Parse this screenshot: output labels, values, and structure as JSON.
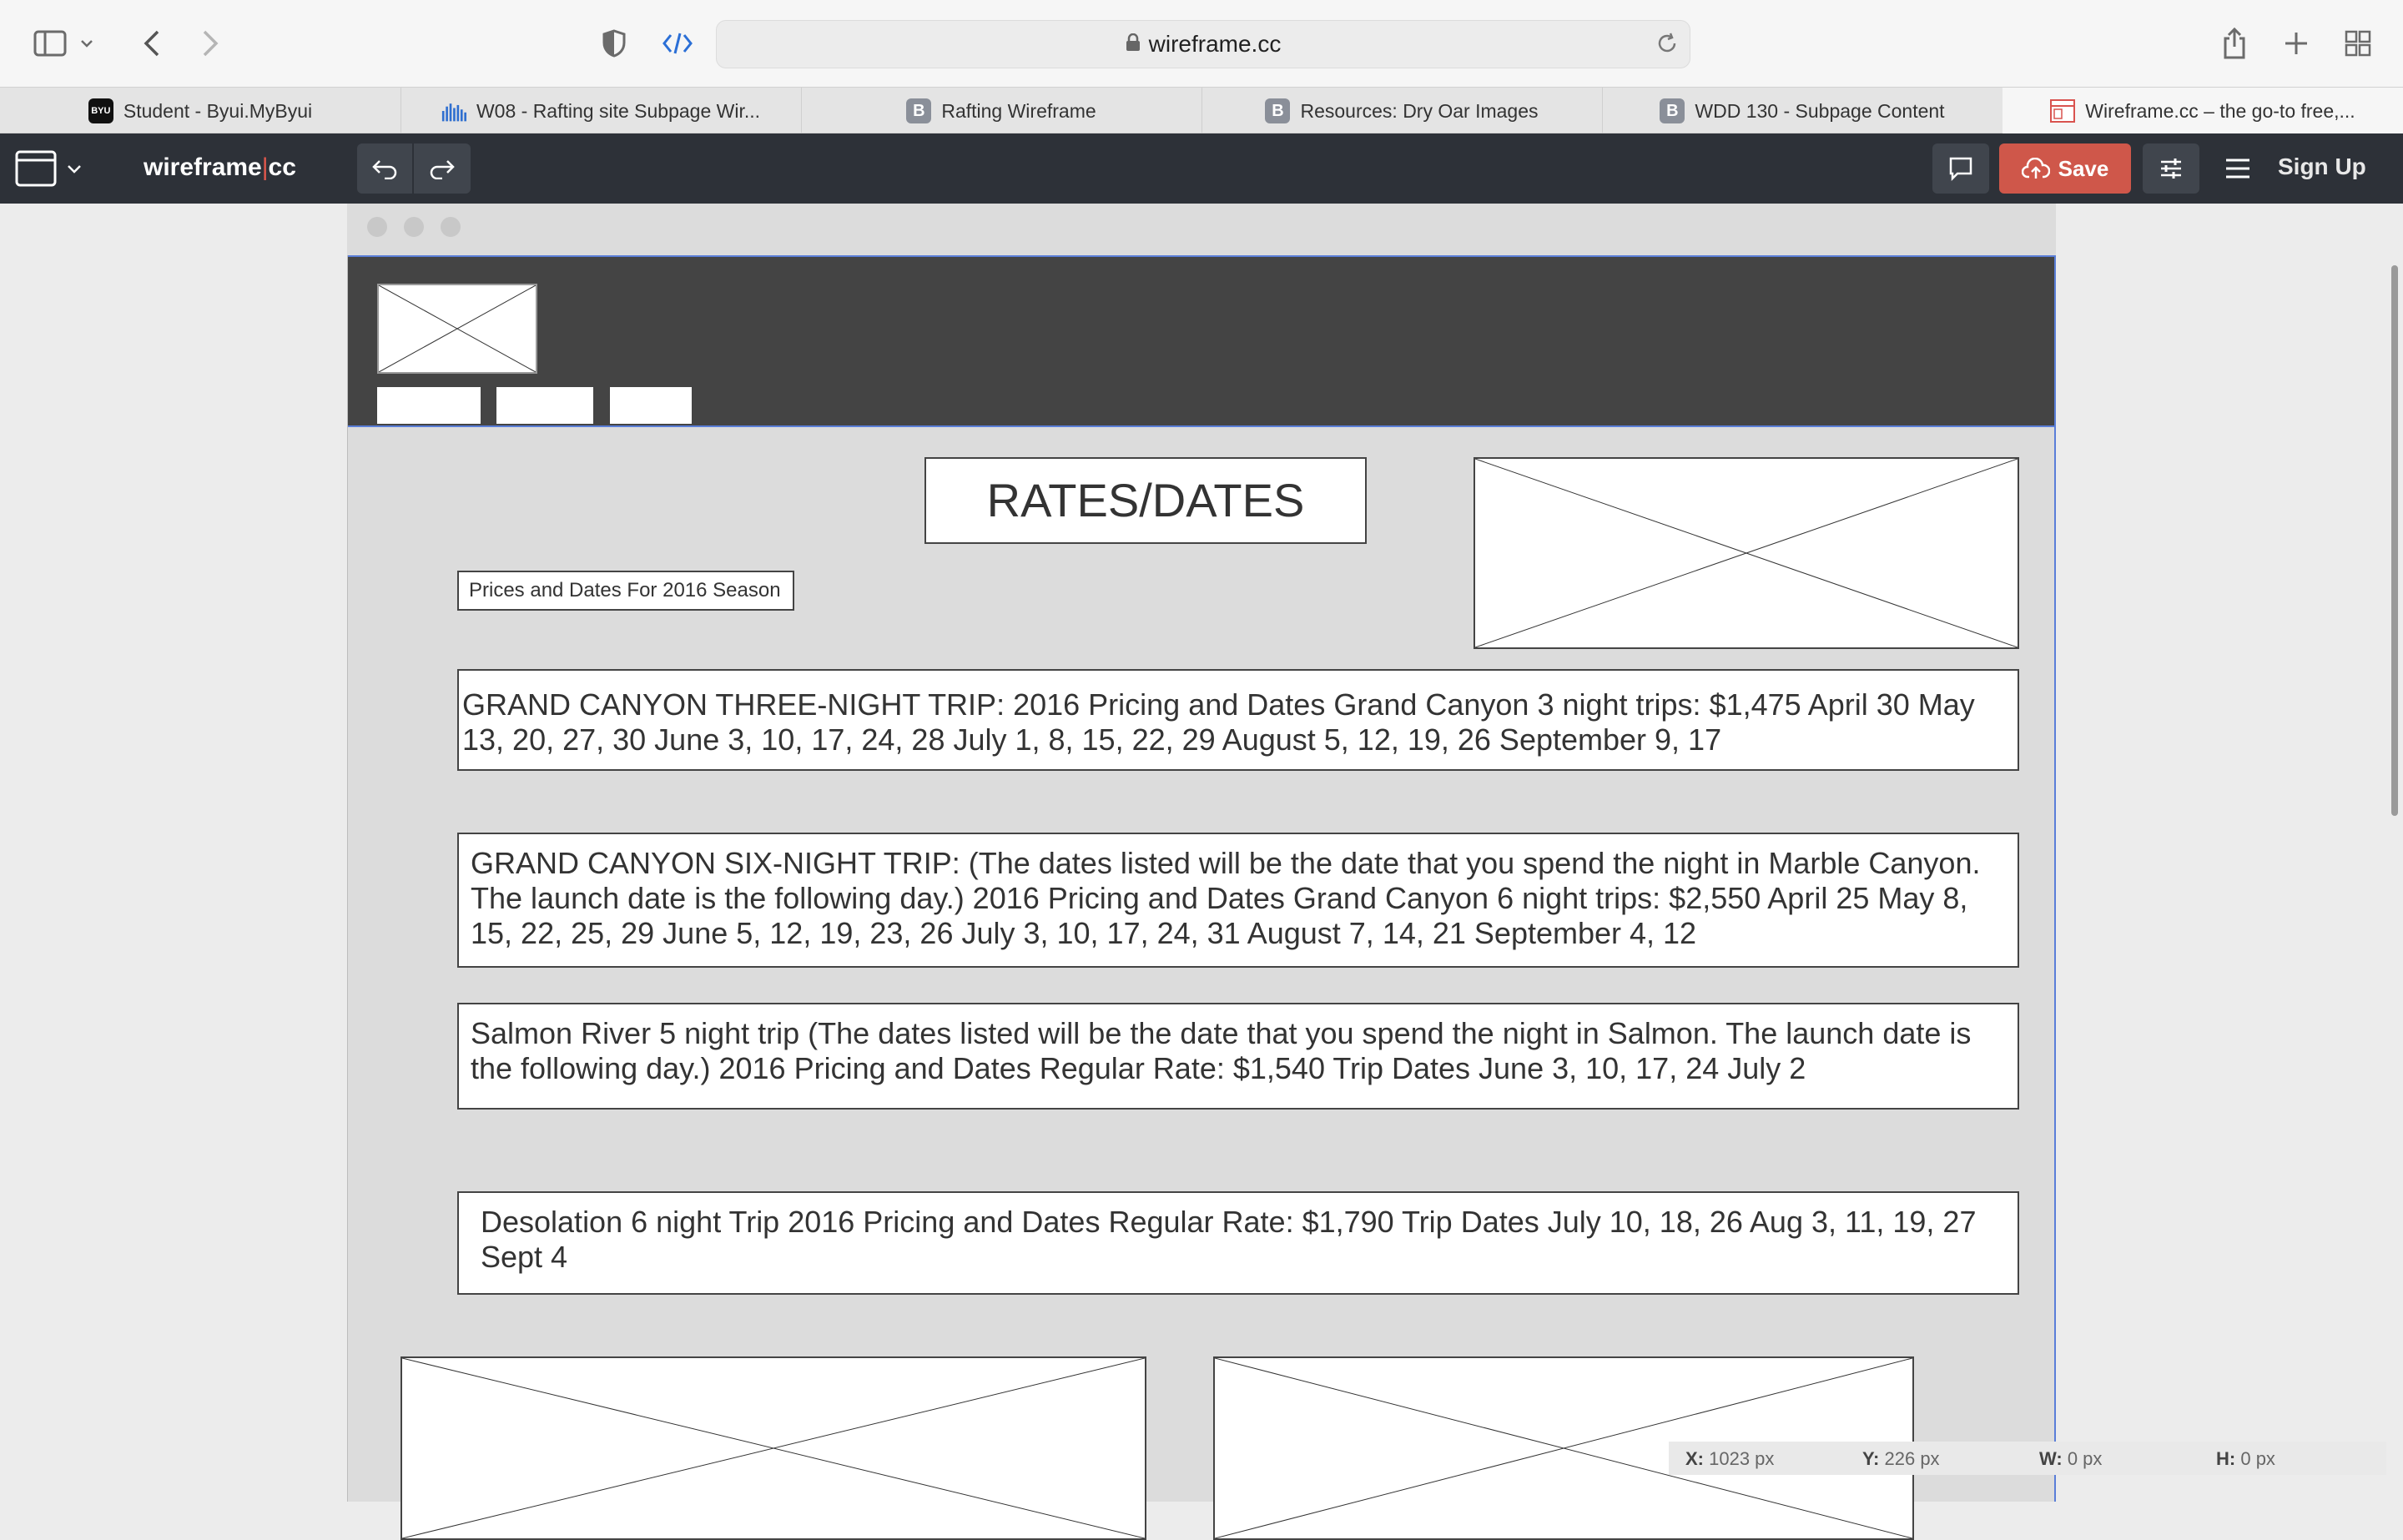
{
  "browser": {
    "url": "wireframe.cc",
    "tabs": [
      {
        "label": "Student - Byui.MyByui",
        "icon": "byui-icon"
      },
      {
        "label": "W08 - Rafting site Subpage Wir...",
        "icon": "chart-bars-icon"
      },
      {
        "label": "Rafting Wireframe",
        "icon": "b-icon"
      },
      {
        "label": "Resources: Dry Oar Images",
        "icon": "b-icon"
      },
      {
        "label": "WDD 130 - Subpage Content",
        "icon": "b-icon"
      },
      {
        "label": "Wireframe.cc – the go-to free,...",
        "icon": "wireframe-icon",
        "active": true
      }
    ]
  },
  "app": {
    "logo_left": "wireframe",
    "logo_right": "cc",
    "save_label": "Save",
    "signup_label": "Sign Up"
  },
  "wireframe": {
    "title": "RATES/DATES",
    "subtitle": "Prices and Dates For 2016 Season",
    "trips": [
      "GRAND CANYON THREE-NIGHT TRIP: 2016 Pricing and Dates Grand Canyon 3 night trips: $1,475 April 30 May 13, 20, 27, 30 June 3, 10, 17, 24, 28 July 1, 8, 15, 22, 29 August 5, 12, 19, 26 September 9, 17",
      "GRAND CANYON SIX-NIGHT TRIP: (The dates listed will be the date that you spend the night in Marble Canyon. The launch date is the following day.) 2016 Pricing and Dates Grand Canyon 6 night trips: $2,550 April 25 May 8, 15, 22, 25, 29 June 5, 12, 19, 23, 26 July 3, 10, 17, 24, 31 August 7, 14, 21 September 4, 12",
      "Salmon River 5 night trip (The dates listed will be the date that you spend the night in Salmon. The launch date is the following day.) 2016 Pricing and Dates Regular Rate: $1,540 Trip Dates June 3, 10, 17, 24 July 2",
      "Desolation 6 night Trip 2016 Pricing and Dates Regular Rate: $1,790 Trip Dates July 10, 18, 26 Aug 3, 11, 19, 27 Sept 4"
    ]
  },
  "status": {
    "x_label": "X:",
    "x_value": "1023 px",
    "y_label": "Y:",
    "y_value": "226 px",
    "w_label": "W:",
    "w_value": "0 px",
    "h_label": "H:",
    "h_value": "0 px"
  },
  "colors": {
    "accent_save": "#cf574a",
    "selection_blue": "#5a7ed8",
    "app_bar": "#2d3138",
    "header_band": "#444444"
  }
}
